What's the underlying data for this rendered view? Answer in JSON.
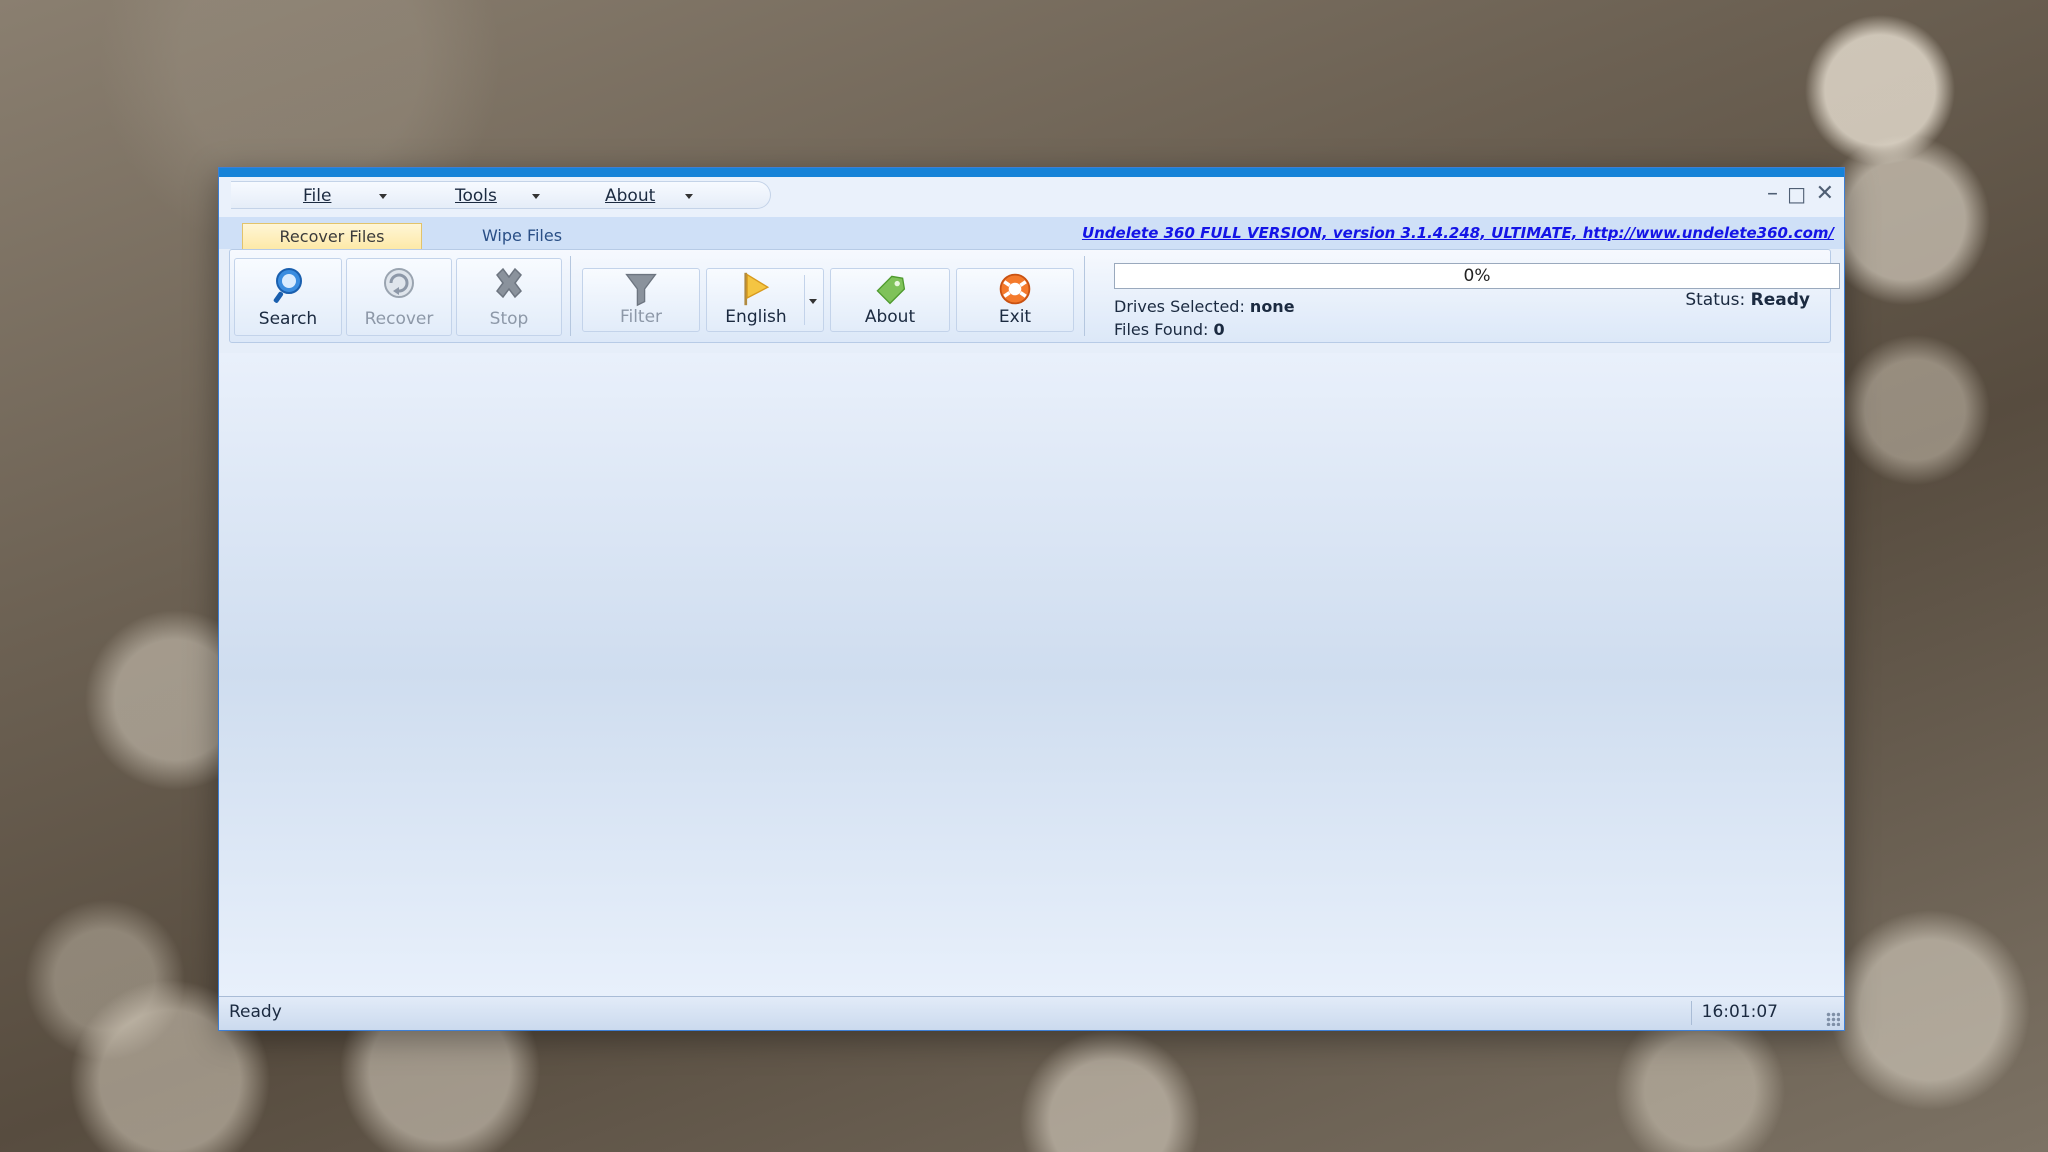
{
  "menu": {
    "file": "File",
    "tools": "Tools",
    "about": "About"
  },
  "window_controls": {
    "minimize": "–",
    "maximize": "□",
    "close": "✕"
  },
  "tabs": [
    {
      "label": "Recover Files",
      "active": true
    },
    {
      "label": "Wipe Files",
      "active": false
    }
  ],
  "promo_link": "Undelete 360 FULL VERSION, version 3.1.4.248, ULTIMATE, http://www.undelete360.com/",
  "toolbar": {
    "search": "Search",
    "recover": "Recover",
    "stop": "Stop",
    "filter": "Filter",
    "language": "English",
    "about": "About",
    "exit": "Exit"
  },
  "progress": {
    "value": 0,
    "label": "0%"
  },
  "info": {
    "drives_label": "Drives Selected:",
    "drives_value": "none",
    "files_label": "Files Found:",
    "files_value": "0",
    "status_label": "Status:",
    "status_value": "Ready"
  },
  "statusbar": {
    "left": "Ready",
    "time": "16:01:07"
  },
  "colors": {
    "accent": "#1683d8",
    "link": "#1414e6",
    "active_tab": "#fde9a8"
  }
}
